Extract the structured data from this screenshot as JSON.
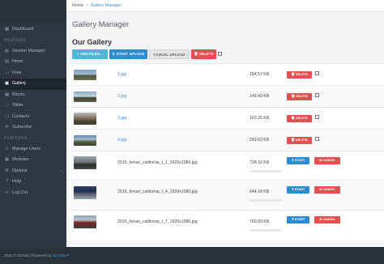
{
  "breadcrumb": {
    "home": "Home",
    "separator": ">",
    "current": "Gallery Manager"
  },
  "page_title": "Gallery Manager",
  "section_title": "Our Gallery",
  "toolbar": {
    "add_files": "+ ADD FILES...",
    "start_upload": "⬆ START UPLOAD",
    "cancel_upload": "CANCEL UPLOAD",
    "delete": "🗑 DELETE"
  },
  "sidebar": {
    "sections": [
      "MODULES",
      "FEATURES"
    ],
    "items": [
      {
        "label": "Dashboard",
        "icon": "dashboard-icon",
        "glyph": "▦"
      },
      {
        "label": "Section Manager",
        "icon": "section-manager-icon",
        "glyph": "▤"
      },
      {
        "label": "News",
        "icon": "news-icon",
        "glyph": "▤"
      },
      {
        "label": "Files",
        "icon": "files-icon",
        "glyph": "□"
      },
      {
        "label": "Gallery",
        "icon": "gallery-icon",
        "glyph": "▣"
      },
      {
        "label": "Blocks",
        "icon": "blocks-icon",
        "glyph": "▦"
      },
      {
        "label": "Slider",
        "icon": "slider-icon",
        "glyph": "□"
      },
      {
        "label": "Contacts",
        "icon": "contacts-icon",
        "glyph": "▢"
      },
      {
        "label": "Subscribe",
        "icon": "subscribe-icon",
        "glyph": "✉"
      },
      {
        "label": "Manage Users",
        "icon": "users-icon",
        "glyph": "☺"
      },
      {
        "label": "Modules",
        "icon": "modules-icon",
        "glyph": "▦"
      },
      {
        "label": "Options",
        "icon": "options-icon",
        "glyph": "⚙"
      },
      {
        "label": "Help",
        "icon": "help-icon",
        "glyph": "?"
      },
      {
        "label": "Log Out",
        "icon": "logout-icon",
        "glyph": "↵"
      }
    ],
    "options_arrow": "‹"
  },
  "files": [
    {
      "name": "1.jpg",
      "size": "184.57 KB",
      "action": "🗑 DELETE"
    },
    {
      "name": "2.jpg",
      "size": "149.43 KB",
      "action": "🗑 DELETE"
    },
    {
      "name": "3.jpg",
      "size": "163.25 KB",
      "action": "🗑 DELETE"
    },
    {
      "name": "4.jpg",
      "size": "243.63 KB",
      "action": "🗑 DELETE"
    }
  ],
  "pending": [
    {
      "name": "2015_ferrari_california_t_1_1920x1080.jpg",
      "size": "728.32 KB",
      "start": "⬆ START",
      "cancel": "⊘ CANCEL",
      "progress": 0
    },
    {
      "name": "2015_ferrari_california_t_4_1920x1080.jpg",
      "size": "644.18 KB",
      "start": "⬆ START",
      "cancel": "⊘ CANCEL",
      "progress": 0
    },
    {
      "name": "2015_ferrari_california_t_7_1920x1080.jpg",
      "size": "769.83 KB",
      "start": "⬆ START",
      "cancel": "⊘ CANCEL",
      "progress": 0
    }
  ],
  "footer": {
    "text": "2016 © mCMS | Powered by",
    "link": "MicroMVP"
  },
  "colors": {
    "accent": "#2f8bd0",
    "danger": "#e0514f",
    "info": "#4fb7d6",
    "sidebar": "#2e3742"
  }
}
